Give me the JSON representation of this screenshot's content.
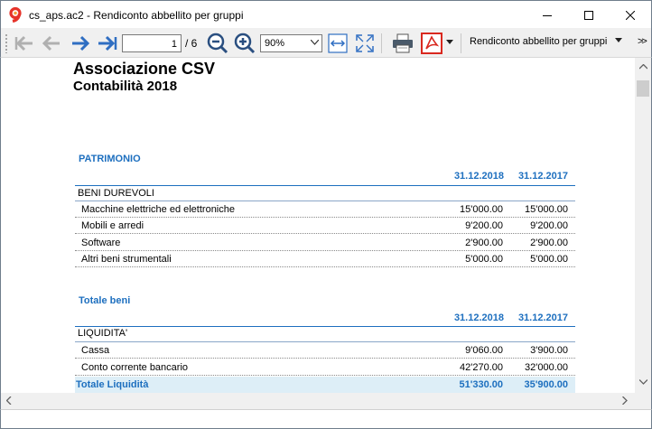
{
  "window": {
    "title": "cs_aps.ac2 - Rendiconto abbellito per gruppi",
    "minimize_icon": "minimize-icon",
    "maximize_icon": "maximize-icon",
    "close_icon": "close-icon"
  },
  "toolbar": {
    "page_value": "1",
    "page_total": "/ 6",
    "zoom_value": "90%",
    "report_name": "Rendiconto abbellito per gruppi",
    "more_label": ">>",
    "icons": [
      "first-page-icon",
      "previous-page-icon",
      "next-page-icon",
      "last-page-icon",
      "zoom-out-icon",
      "zoom-in-icon",
      "fit-width-icon",
      "fit-page-icon",
      "print-icon",
      "pdf-icon"
    ]
  },
  "report": {
    "org_name": "Associazione CSV",
    "org_year": "Contabilità 2018",
    "section1": {
      "title": "PATRIMONIO",
      "col1": "31.12.2018",
      "col2": "31.12.2017",
      "group": "BENI DUREVOLI",
      "rows": [
        {
          "label": "Macchine elettriche ed elettroniche",
          "v1": "15'000.00",
          "v2": "15'000.00"
        },
        {
          "label": "Mobili e arredi",
          "v1": "9'200.00",
          "v2": "9'200.00"
        },
        {
          "label": "Software",
          "v1": "2'900.00",
          "v2": "2'900.00"
        },
        {
          "label": "Altri beni strumentali",
          "v1": "5'000.00",
          "v2": "5'000.00"
        }
      ]
    },
    "section2": {
      "title": "Totale beni",
      "col1": "31.12.2018",
      "col2": "31.12.2017",
      "group": "LIQUIDITA'",
      "rows": [
        {
          "label": "Cassa",
          "v1": "9'060.00",
          "v2": "3'900.00"
        },
        {
          "label": "Conto corrente bancario",
          "v1": "42'270.00",
          "v2": "32'000.00"
        }
      ],
      "total": {
        "label": "Totale Liquidità",
        "v1": "51'330.00",
        "v2": "35'900.00"
      }
    }
  },
  "colors": {
    "accent": "#1d6fbf",
    "total_bg": "#ddeef7",
    "nav_arrow_active": "#2f6ec2",
    "nav_arrow_disabled": "#b0b0b0",
    "pdf_red": "#d9281f"
  }
}
